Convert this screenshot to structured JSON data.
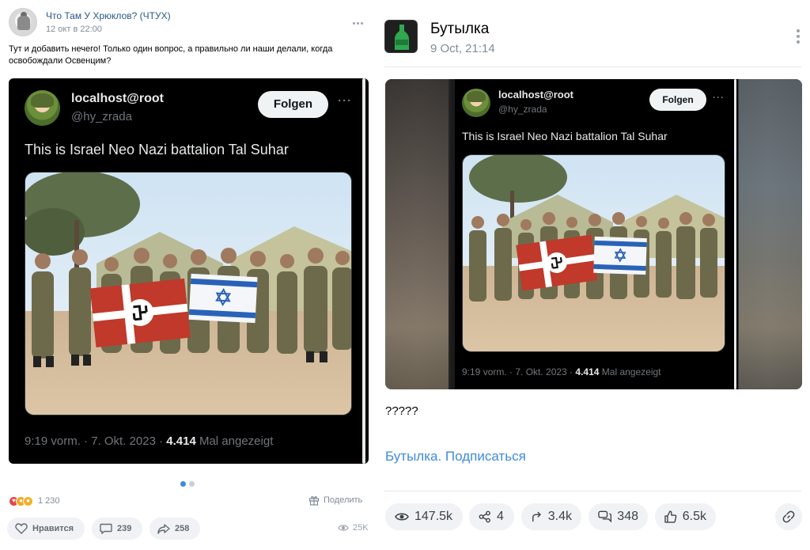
{
  "left_post": {
    "author": "Что Там У Хрюклов? (ЧТУХ)",
    "date": "12 окт в 22:00",
    "text": "Тут и добавить нечего! Только один вопрос, а правильно ли наши делали, когда освобождали Освенцим?",
    "reactions_count": "1 230",
    "share_label": "Поделить",
    "like_label": "Нравится",
    "comments_count": "239",
    "reposts_count": "258",
    "views": "25K",
    "pager_active": 1,
    "pager_total": 2
  },
  "tweet": {
    "display_name": "localhost@root",
    "handle": "@hy_zrada",
    "follow_label": "Folgen",
    "text": "This is Israel Neo Nazi battalion Tal Suhar",
    "time": "9:19 vorm. · 7. Okt. 2023 ·",
    "views_count": "4.414",
    "views_label": "Mal angezeigt"
  },
  "right_post": {
    "author": "Бутылка",
    "date": "9 Oct, 21:14",
    "text": "?????",
    "subscribe_link": "Бутылка. Подписаться",
    "views": "147.5k",
    "shares": "4",
    "reposts": "3.4k",
    "comments": "348",
    "likes": "6.5k"
  },
  "colors": {
    "link": "#2a5885",
    "accent": "#3f8ae0",
    "muted": "#818c99",
    "pill_bg": "#f0f2f5",
    "tweet_bg": "#000000",
    "follow_bg": "#eff3f4"
  },
  "icons": [
    "more-dots-icon",
    "heart-icon",
    "comment-icon",
    "repost-icon",
    "eye-icon",
    "gift-icon",
    "share-nodes-icon",
    "link-icon",
    "bottle-icon"
  ]
}
